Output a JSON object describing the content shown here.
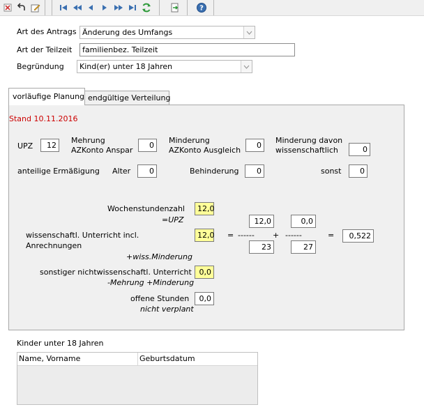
{
  "toolbar": {
    "icons": [
      "delete-icon",
      "undo-icon",
      "edit-icon",
      "first-record-icon",
      "fast-back-icon",
      "previous-icon",
      "next-icon",
      "fast-forward-icon",
      "last-record-icon",
      "refresh-icon",
      "export-icon",
      "help-icon"
    ]
  },
  "header": {
    "art_antrag_label": "Art des Antrags",
    "art_antrag_value": "Änderung des Umfangs",
    "art_teilzeit_label": "Art der Teilzeit",
    "art_teilzeit_value": "familienbez. Teilzeit",
    "begruendung_label": "Begründung",
    "begruendung_value": "Kind(er) unter 18 Jahren"
  },
  "tabs": [
    {
      "label": "vorläufige Planung",
      "active": true
    },
    {
      "label": "endgültige Verteilung",
      "active": false
    }
  ],
  "planung": {
    "stand": "Stand 10.11.2016",
    "upz_label": "UPZ",
    "upz_value": "12",
    "mehrung_label_1": "Mehrung",
    "mehrung_label_2": "AZKonto Anspar",
    "mehrung_value": "0",
    "minderung_label_1": "Minderung",
    "minderung_label_2": "AZKonto Ausgleich",
    "minderung_value": "0",
    "minderung_wiss_label_1": "Minderung davon",
    "minderung_wiss_label_2": "wissenschaftlich",
    "minderung_wiss_value": "0",
    "anteilige_label": "anteilige Ermäßigung",
    "alter_label": "Alter",
    "alter_value": "0",
    "behinderung_label": "Behinderung",
    "behinderung_value": "0",
    "sonst_label": "sonst",
    "sonst_value": "0",
    "wochenstunden_label": "Wochenstundenzahl",
    "wochenstunden_sub": "=UPZ",
    "wochenstunden_value": "12,0",
    "wiss_unterricht_label_1": "wissenschaftl. Unterricht incl.",
    "wiss_unterricht_label_2": "Anrechnungen",
    "wiss_unterricht_sub": "+wiss.Minderung",
    "wiss_unterricht_value": "12,0",
    "eq1": "=",
    "dashes_left": "------",
    "plus": "+",
    "dashes_right": "------",
    "eq2": "=",
    "frac1_num": "12,0",
    "frac1_den": "23",
    "frac2_num": "0,0",
    "frac2_den": "27",
    "result": "0,522",
    "sonstiger_label": "sonstiger nichtwissenschaftl. Unterricht",
    "sonstiger_sub": "-Mehrung +Minderung",
    "sonstiger_value": "0,0",
    "offene_label": "offene Stunden",
    "offene_sub": "nicht verplant",
    "offene_value": "0,0"
  },
  "kinder": {
    "title": "Kinder unter 18 Jahren",
    "columns": [
      "Name, Vorname",
      "Geburtsdatum"
    ],
    "rows": []
  },
  "colors": {
    "stand": "#cc0000",
    "highlight": "#ffff99",
    "panel": "#f0f0f0"
  }
}
